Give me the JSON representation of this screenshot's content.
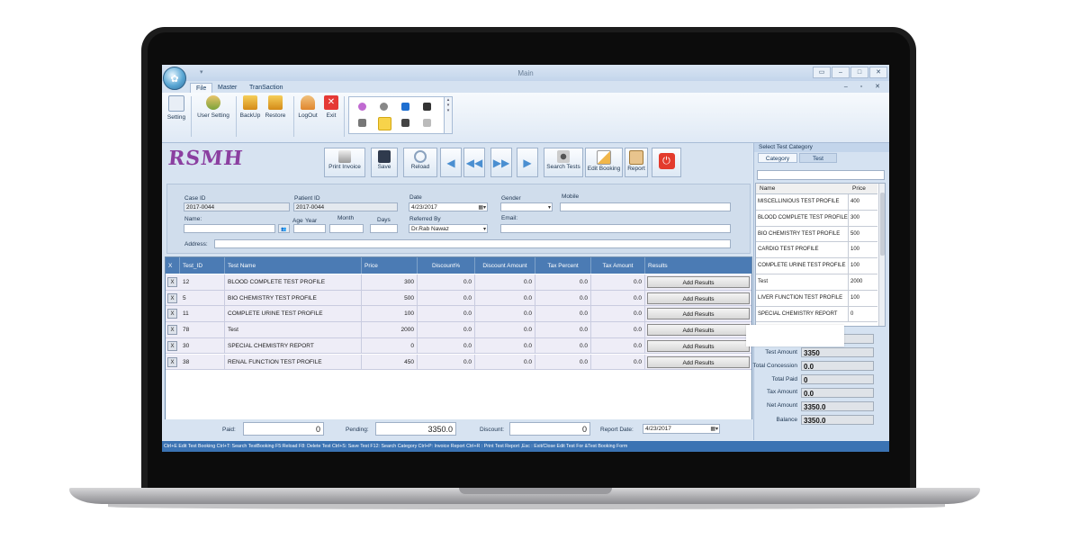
{
  "window": {
    "title": "Main"
  },
  "ribbon": {
    "tabs": [
      "File",
      "Master",
      "TranSaction"
    ],
    "buttons": [
      "Setting",
      "User Setting",
      "BackUp",
      "Restore",
      "LogOut",
      "Exit"
    ]
  },
  "logo": "RSMH",
  "toolbar": {
    "print_invoice": "Print Invoice",
    "save": "Save",
    "reload": "Reload",
    "search_tests": "Search Tests",
    "edit_booking": "Edit Booking",
    "report": "Report"
  },
  "form": {
    "case_id_label": "Case ID",
    "case_id": "2017-0044",
    "patient_id_label": "Patient ID",
    "patient_id": "2017-0044",
    "date_label": "Date",
    "date": "4/23/2017",
    "gender_label": "Gender",
    "mobile_label": "Mobile",
    "name_label": "Name:",
    "age_label": "Age",
    "year_label": "Year",
    "month_label": "Month",
    "days_label": "Days",
    "referred_by_label": "Referred By",
    "referred_by": "Dr.Rab Nawaz",
    "email_label": "Email:",
    "address_label": "Address:"
  },
  "grid": {
    "headers": [
      "X",
      "Test_ID",
      "Test Name",
      "Price",
      "Discount%",
      "Discount Amount",
      "Tax Percent",
      "Tax Amount",
      "Results"
    ],
    "rows": [
      {
        "x": "X",
        "test_id": "12",
        "name": "BLOOD COMPLETE TEST PROFILE",
        "price": "300",
        "disc_pct": "0.0",
        "disc_amt": "0.0",
        "tax_pct": "0.0",
        "tax_amt": "0.0",
        "action": "Add Results"
      },
      {
        "x": "X",
        "test_id": "5",
        "name": "BIO CHEMISTRY TEST PROFILE",
        "price": "500",
        "disc_pct": "0.0",
        "disc_amt": "0.0",
        "tax_pct": "0.0",
        "tax_amt": "0.0",
        "action": "Add Results"
      },
      {
        "x": "X",
        "test_id": "11",
        "name": "COMPLETE URINE TEST PROFILE",
        "price": "100",
        "disc_pct": "0.0",
        "disc_amt": "0.0",
        "tax_pct": "0.0",
        "tax_amt": "0.0",
        "action": "Add Results"
      },
      {
        "x": "X",
        "test_id": "78",
        "name": "Test",
        "price": "2000",
        "disc_pct": "0.0",
        "disc_amt": "0.0",
        "tax_pct": "0.0",
        "tax_amt": "0.0",
        "action": "Add Results"
      },
      {
        "x": "X",
        "test_id": "30",
        "name": "SPECIAL CHEMISTRY REPORT",
        "price": "0",
        "disc_pct": "0.0",
        "disc_amt": "0.0",
        "tax_pct": "0.0",
        "tax_amt": "0.0",
        "action": "Add Results"
      },
      {
        "x": "X",
        "test_id": "38",
        "name": "RENAL FUNCTION TEST PROFILE",
        "price": "450",
        "disc_pct": "0.0",
        "disc_amt": "0.0",
        "tax_pct": "0.0",
        "tax_amt": "0.0",
        "action": "Add Results"
      }
    ]
  },
  "footer": {
    "paid_label": "Paid:",
    "paid": "0",
    "pending_label": "Pending:",
    "pending": "3350.0",
    "discount_label": "Discount:",
    "discount": "0",
    "report_date_label": "Report Date:",
    "report_date": "4/23/2017"
  },
  "status_bar": "Ctrl+E Edit Test Booking Ctrl+T: Search TestBooking F5:Reload F8: Delete Test Ctrl+S: Save Test F12: Search Category Ctrl+P: Invoice Report Ctrl+R : Print Test Report ,Esc : Exit/Close Edit Test For &Test Booking Form",
  "category_panel": {
    "title": "Select Test Category",
    "tabs": [
      "Category",
      "Test"
    ],
    "headers": [
      "Name",
      "Price"
    ],
    "items": [
      {
        "name": "MISCELLINIOUS TEST PROFILE",
        "price": "400"
      },
      {
        "name": "BLOOD COMPLETE TEST PROFILE",
        "price": "300"
      },
      {
        "name": "BIO CHEMISTRY TEST PROFILE",
        "price": "500"
      },
      {
        "name": "CARDIO TEST PROFILE",
        "price": "100"
      },
      {
        "name": "COMPLETE URINE TEST PROFILE",
        "price": "100"
      },
      {
        "name": "Test",
        "price": "2000"
      },
      {
        "name": "LIVER FUNCTION TEST PROFILE",
        "price": "100"
      },
      {
        "name": "SPECIAL CHEMISTRY REPORT",
        "price": "0"
      }
    ]
  },
  "summary": {
    "test_amount_label": "Test Amount",
    "test_amount": "3350",
    "total_concession_label": "Total Concession",
    "total_concession": "0.0",
    "total_paid_label": "Total Paid",
    "total_paid": "0",
    "tax_amount_label": "Tax Amount",
    "tax_amount": "0.0",
    "net_amount_label": "Net Amount",
    "net_amount": "3350.0",
    "balance_label": "Balance",
    "balance": "3350.0"
  },
  "colors": {
    "accent": "#4b7bb4",
    "logo": "#8b3fa0",
    "status_bar": "#3b73b3"
  }
}
